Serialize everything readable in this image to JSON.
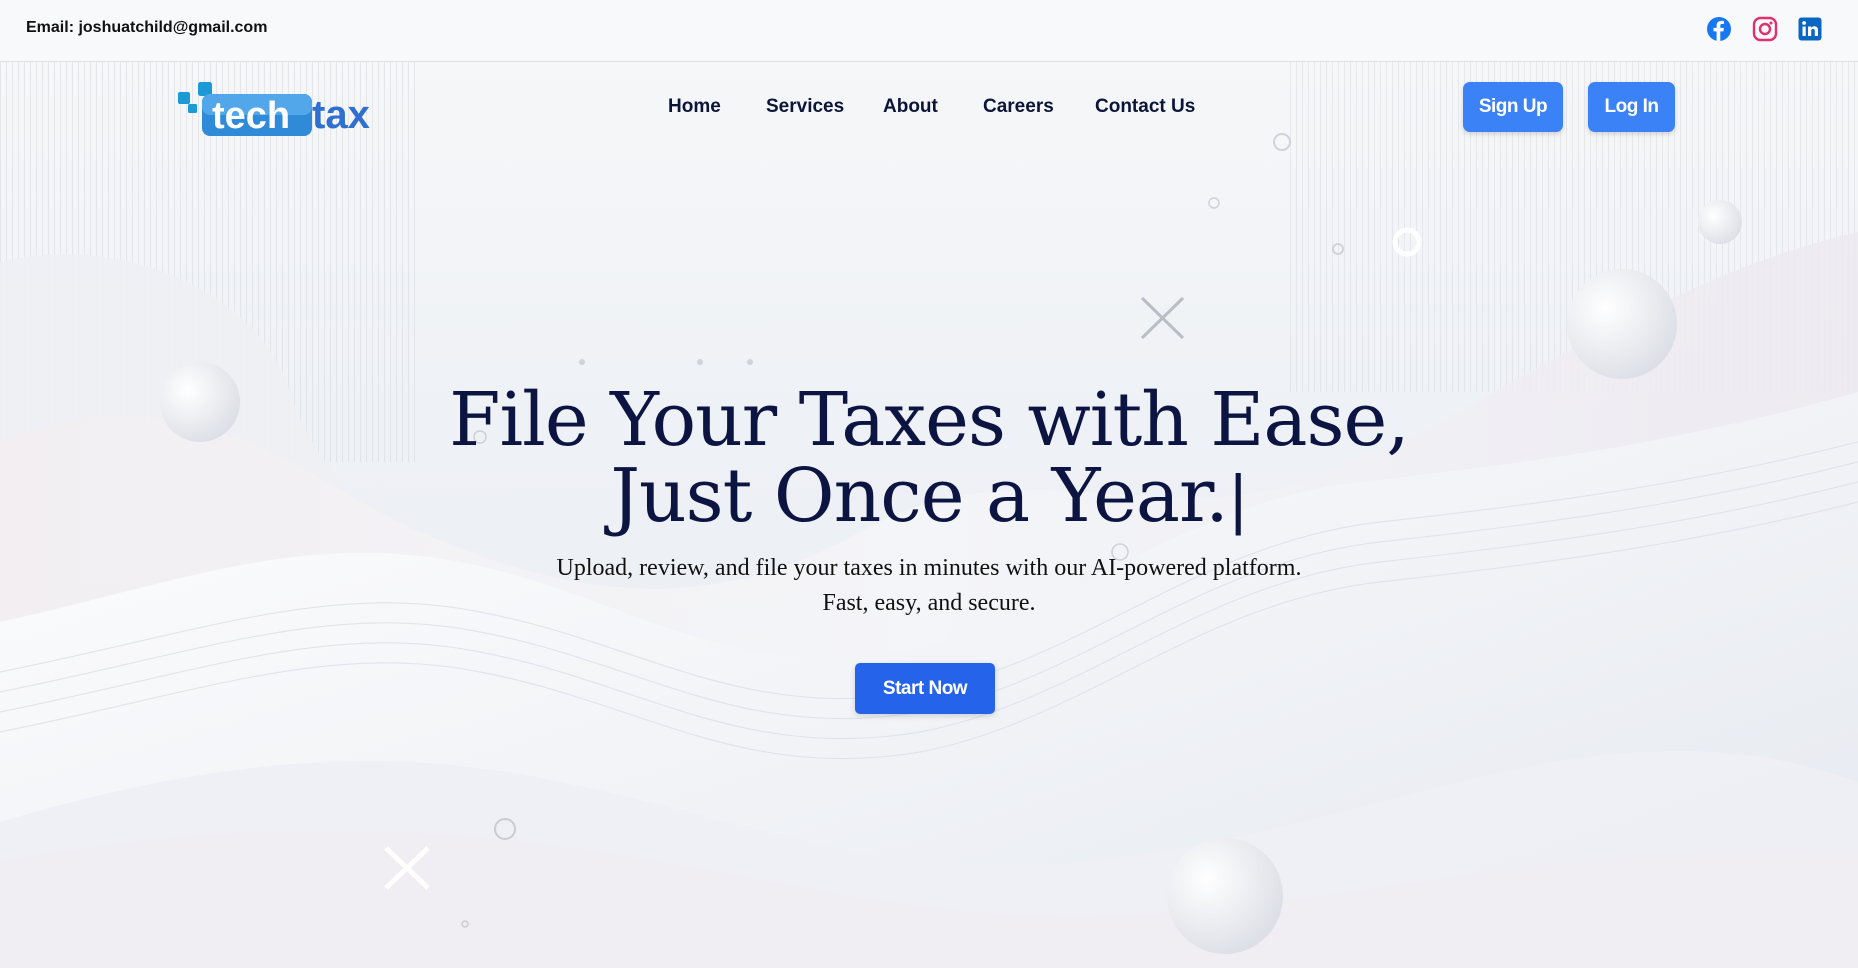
{
  "topbar": {
    "email": "Email: joshuatchild@gmail.com",
    "social": [
      {
        "icon": "facebook-icon",
        "color": "#1877f2"
      },
      {
        "icon": "instagram-icon",
        "color": "#e1306c"
      },
      {
        "icon": "linkedin-icon",
        "color": "#0a66c2"
      }
    ]
  },
  "logo": {
    "part1": "tech",
    "part2": "tax"
  },
  "nav": {
    "items": [
      {
        "label": "Home"
      },
      {
        "label": "Services"
      },
      {
        "label": "About"
      },
      {
        "label": "Careers"
      },
      {
        "label": "Contact Us"
      }
    ]
  },
  "auth": {
    "signup": "Sign Up",
    "login": "Log In"
  },
  "hero": {
    "line1": "File Your Taxes with Ease,",
    "line2": "Just Once a Year.",
    "cursor": "|",
    "subline1": "Upload, review, and file your taxes in minutes with our AI-powered platform.",
    "subline2": "Fast, easy, and secure.",
    "cta": "Start Now"
  },
  "colors": {
    "accent": "#3b82f6",
    "cta": "#2563eb",
    "headline": "#0c1542"
  }
}
